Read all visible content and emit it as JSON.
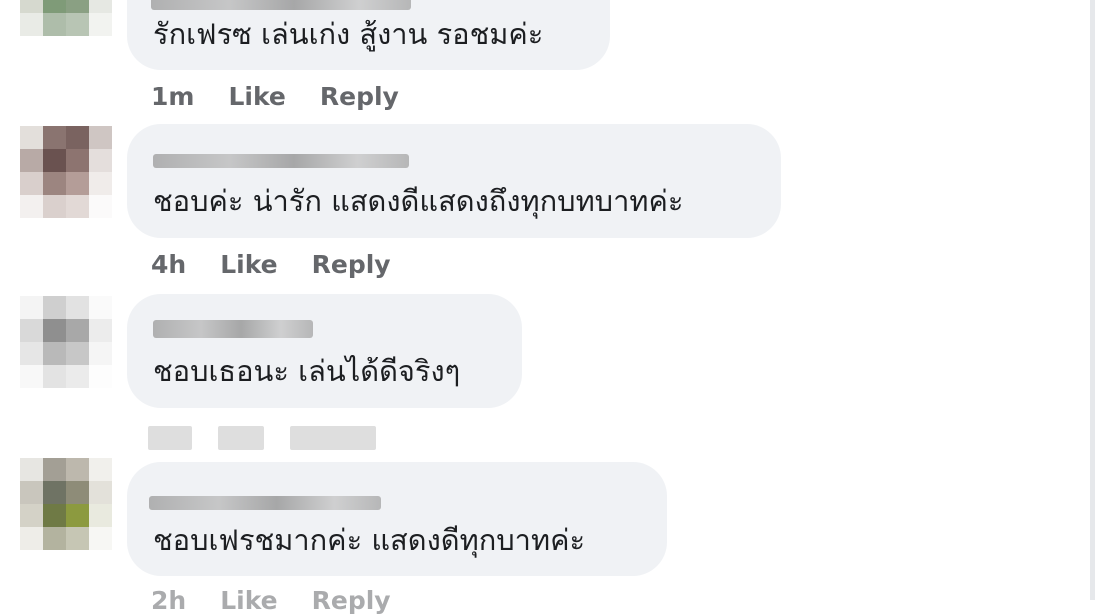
{
  "comments": [
    {
      "text": "รักเฟรซ เล่นเก่ง สู้งาน รอชมค่ะ",
      "time": "1m",
      "like": "Like",
      "reply": "Reply"
    },
    {
      "text": "ชอบค่ะ น่ารัก แสดงดีแสดงถึงทุกบทบาทค่ะ",
      "time": "4h",
      "like": "Like",
      "reply": "Reply"
    },
    {
      "text": "ชอบเธอนะ เล่นได้ดีจริงๆ"
    },
    {
      "text": "ชอบเฟรชมากค่ะ แสดงดีทุกบาทค่ะ",
      "time": "2h",
      "like": "Like",
      "reply": "Reply"
    }
  ],
  "colors": {
    "bubble": "#f0f2f5",
    "comment_text": "#1c1e21",
    "action_text": "#65676b"
  }
}
